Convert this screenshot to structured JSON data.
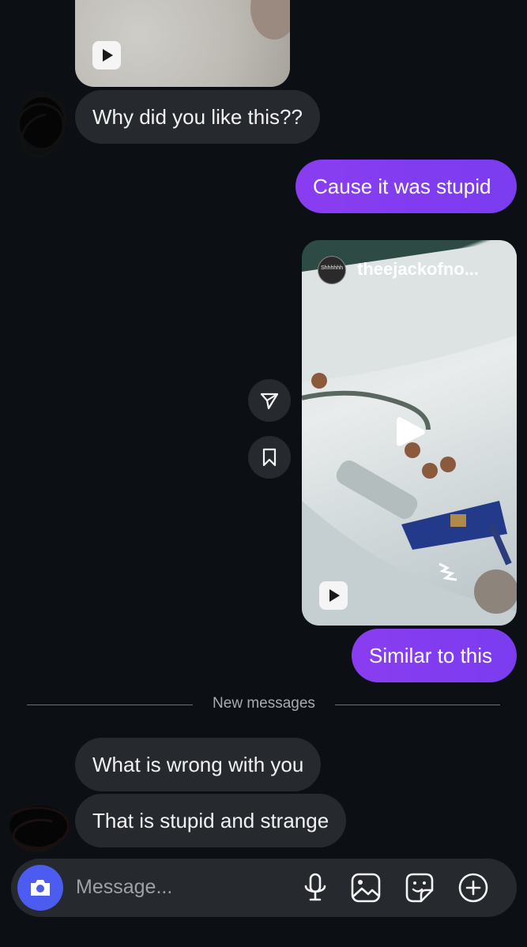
{
  "messages": {
    "m1": "Why did you like this??",
    "m2": "Cause it was stupid",
    "m3": "Similar to this",
    "m4": "What is wrong with you",
    "m5": "That is stupid and strange"
  },
  "shared_post": {
    "username": "theejackofno...",
    "avatar_text": "Shhhhhh"
  },
  "divider": {
    "label": "New messages"
  },
  "composer": {
    "placeholder": "Message..."
  },
  "colors": {
    "background": "#0c1014",
    "incoming_bubble": "#262a2f",
    "outgoing_bubble": "#7c3aed",
    "camera_button": "#4c5cf0"
  },
  "icons": [
    "play-icon",
    "share-icon",
    "bookmark-icon",
    "camera-icon",
    "microphone-icon",
    "gallery-icon",
    "sticker-icon",
    "add-icon"
  ]
}
